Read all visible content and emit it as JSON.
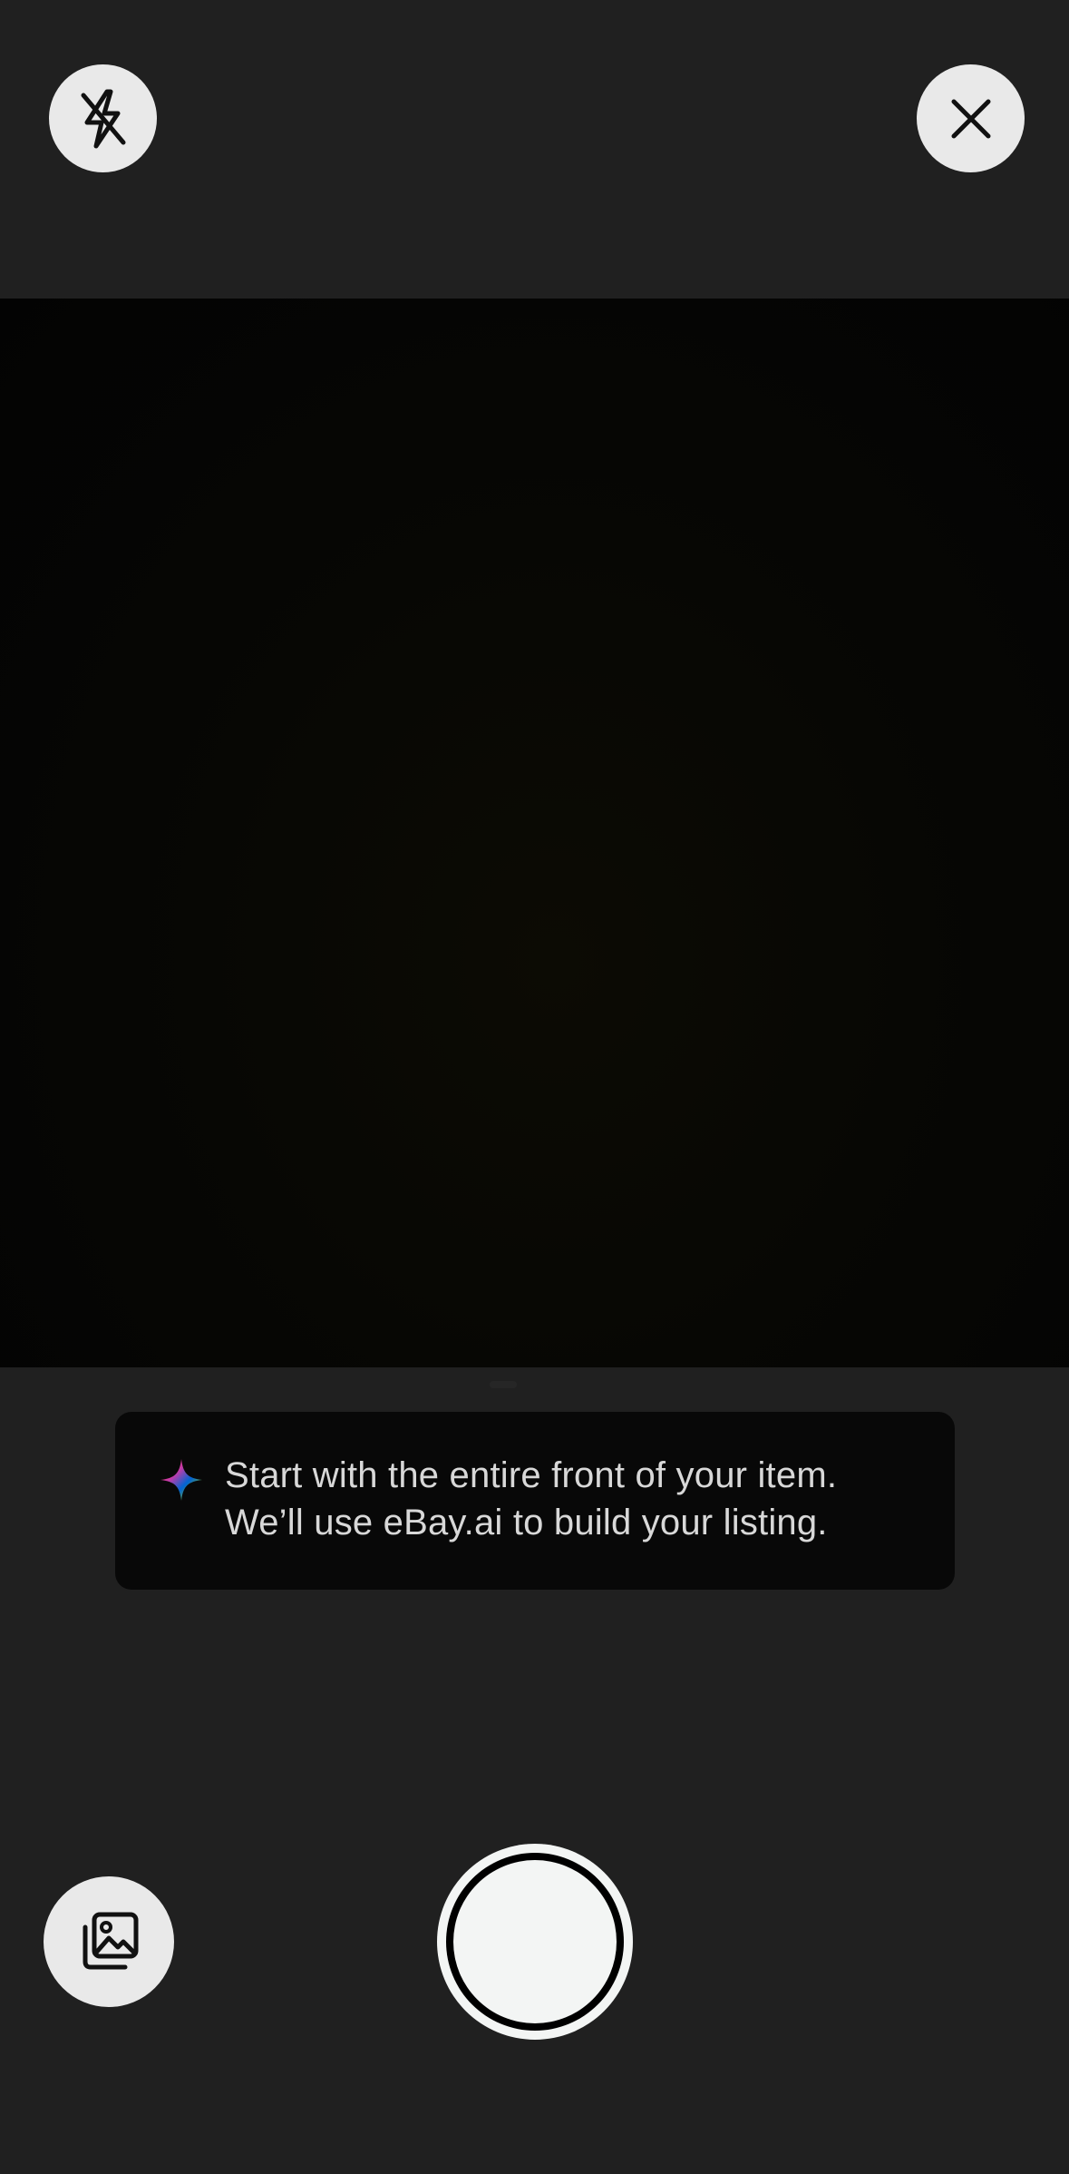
{
  "camera": {
    "flash_icon": "flash-off-icon",
    "close_icon": "close-icon",
    "gallery_icon": "photo-gallery-icon",
    "shutter_icon": "shutter-button"
  },
  "tip": {
    "icon": "ai-sparkle-icon",
    "line1": "Start with the entire front of your item.",
    "line2": "We’ll use eBay.ai to build your listing."
  },
  "colors": {
    "background": "#202020",
    "button_bg": "#e9e9e9",
    "tip_bg": "#080808",
    "tip_text": "#d8d8d8",
    "sparkle_colors": [
      "#e53238",
      "#0064d2",
      "#f5af02",
      "#86b817"
    ]
  }
}
